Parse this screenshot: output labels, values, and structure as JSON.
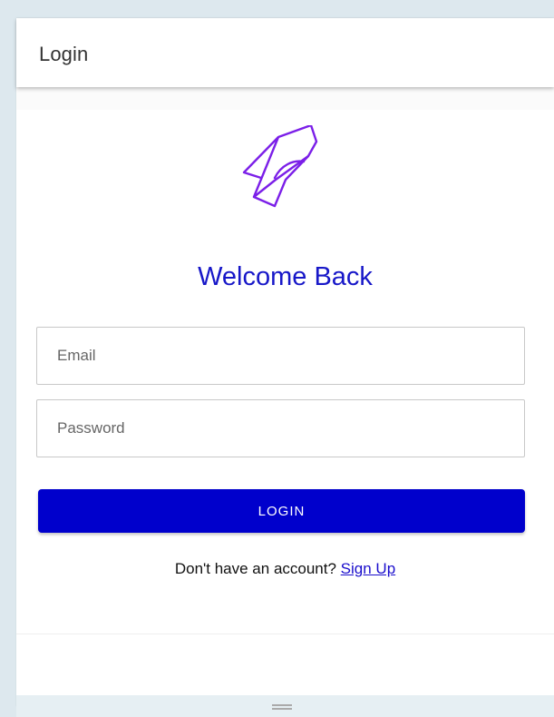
{
  "app": {
    "title": "Login"
  },
  "logo": {
    "icon": "paper-plane-logo-icon",
    "color": "#7b1fe8"
  },
  "form": {
    "heading": "Welcome Back",
    "email": {
      "placeholder": "Email",
      "value": ""
    },
    "password": {
      "placeholder": "Password",
      "value": ""
    },
    "login_label": "LOGIN"
  },
  "footer": {
    "prompt": "Don't have an account? ",
    "signup_label": "Sign Up"
  },
  "colors": {
    "accent": "#0000cc",
    "heading": "#1717c8",
    "link": "#1a0dcc"
  },
  "window": {
    "resize_icon": "resize-handle-icon"
  }
}
